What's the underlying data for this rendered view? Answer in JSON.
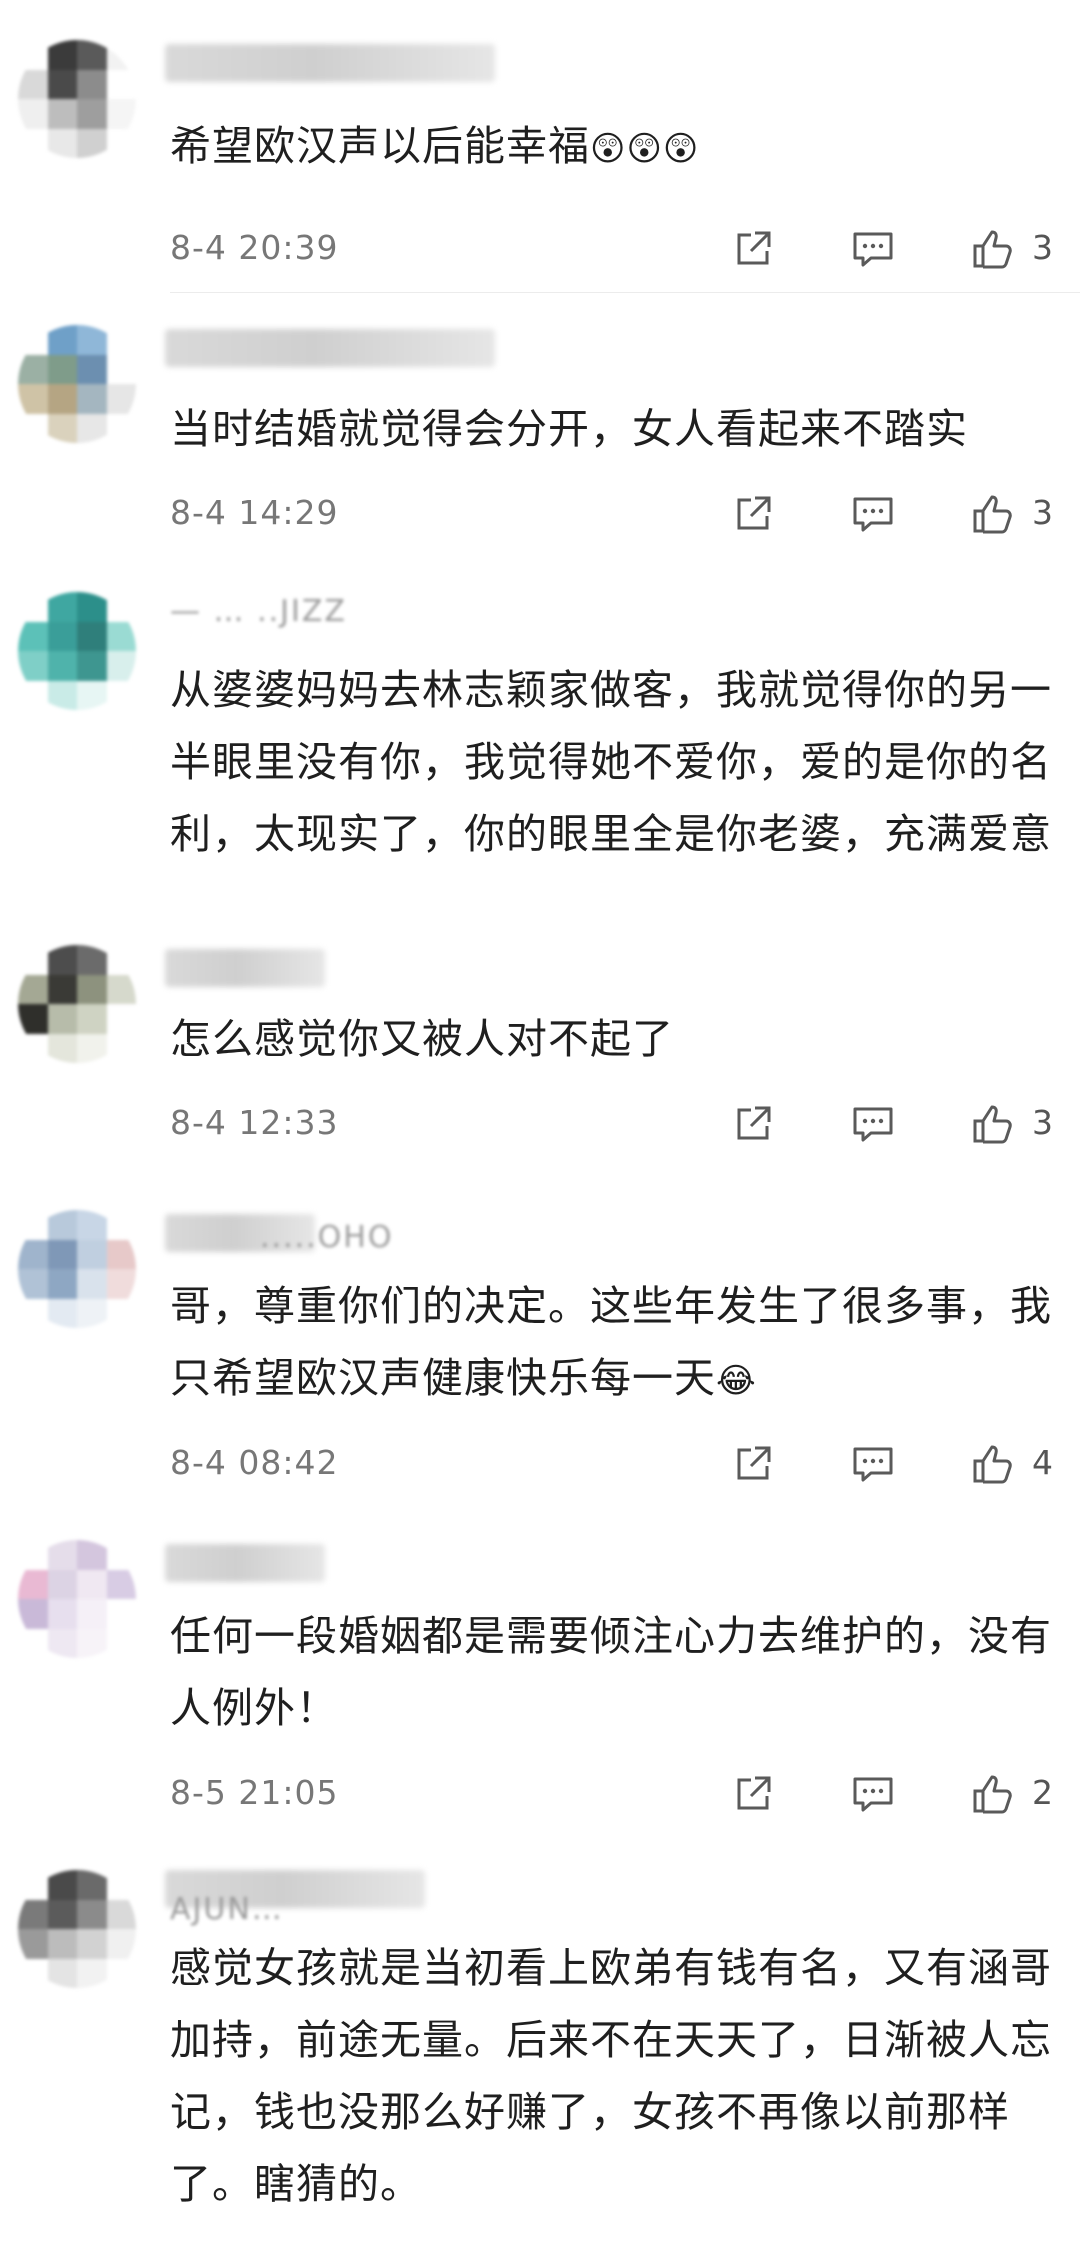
{
  "comments": [
    {
      "username": "",
      "text": "希望欧汉声以后能幸福",
      "emoji": "😲😲😲",
      "time": "8-4 20:39",
      "likes": "3",
      "avatar_colors": [
        "#ffffff",
        "#3b3b3b",
        "#5a5a5a",
        "#f2f2f2",
        "#d9d9d9",
        "#4a4a4a",
        "#8c8c8c",
        "#ffffff",
        "#efefef",
        "#bdbdbd",
        "#9e9e9e",
        "#f5f5f5",
        "#ffffff",
        "#e8e8e8",
        "#d0d0d0",
        "#ffffff"
      ]
    },
    {
      "username": "",
      "text": "当时结婚就觉得会分开，女人看起来不踏实",
      "emoji": "",
      "time": "8-4 14:29",
      "likes": "3",
      "avatar_colors": [
        "#ffffff",
        "#6fa0c8",
        "#8fb7d8",
        "#ffffff",
        "#9bb0a4",
        "#7f9c8a",
        "#6c8fb0",
        "#ffffff",
        "#cfc3a6",
        "#b5a583",
        "#a4b6c0",
        "#e6e6e6",
        "#ffffff",
        "#dad2bd",
        "#e7e7e7",
        "#ffffff"
      ]
    },
    {
      "username": "—  …  ..JIZZ",
      "text": "从婆婆妈妈去林志颖家做客，我就觉得你的另一半眼里没有你，我觉得她不爱你，爱的是你的名利，太现实了，你的眼里全是你老婆，充满爱意",
      "emoji": "",
      "time": "",
      "likes": "",
      "avatar_colors": [
        "#ffffff",
        "#3fa7a1",
        "#2c8f8a",
        "#ffffff",
        "#5cc1b8",
        "#3a9e99",
        "#2f7f7b",
        "#9adbd3",
        "#7fcfc7",
        "#4fb3ab",
        "#3e9690",
        "#d8efec",
        "#ffffff",
        "#c9ebe7",
        "#e7f6f4",
        "#ffffff"
      ]
    },
    {
      "username": "",
      "text": "怎么感觉你又被人对不起了",
      "emoji": "",
      "time": "8-4 12:33",
      "likes": "3",
      "avatar_colors": [
        "#ffffff",
        "#4d4d4d",
        "#6b6b6b",
        "#ffffff",
        "#a4a894",
        "#3a3a36",
        "#8d927e",
        "#d6d9cc",
        "#2f2f2b",
        "#b7bcaa",
        "#cfd3c3",
        "#ffffff",
        "#ffffff",
        "#e4e6dc",
        "#f1f2ec",
        "#ffffff"
      ]
    },
    {
      "username": ".....OHO",
      "text": "哥，尊重你们的决定。这些年发生了很多事，我只希望欧汉声健康快乐每一天",
      "emoji": "😂",
      "time": "8-4 08:42",
      "likes": "4",
      "avatar_colors": [
        "#ffffff",
        "#b8c9db",
        "#c8d6e6",
        "#ffffff",
        "#9fb4cc",
        "#7f98b7",
        "#c0cfe0",
        "#e7c9c9",
        "#b0c2d6",
        "#8ea7c3",
        "#d9e2ec",
        "#f0dcdc",
        "#ffffff",
        "#e3eaf2",
        "#eef2f6",
        "#ffffff"
      ]
    },
    {
      "username": "",
      "text": "任何一段婚姻都是需要倾注心力去维护的，没有人例外！",
      "emoji": "",
      "time": "8-5 21:05",
      "likes": "2",
      "avatar_colors": [
        "#ffffff",
        "#e5ddea",
        "#d4c6de",
        "#ffffff",
        "#e9b9d3",
        "#dcd3e4",
        "#f0e8f2",
        "#d8cce4",
        "#c9b9d8",
        "#e7dfee",
        "#f5f0f7",
        "#ffffff",
        "#ffffff",
        "#eee8f2",
        "#f7f3f8",
        "#ffffff"
      ]
    },
    {
      "username": "AJUN…",
      "text": "感觉女孩就是当初看上欧弟有钱有名，又有涵哥加持，前途无量。后来不在天天了，日渐被人忘记，钱也没那么好赚了，女孩不再像以前那样了。瞎猜的。",
      "emoji": "",
      "time": "",
      "likes": "",
      "avatar_colors": [
        "#ffffff",
        "#4a4a4a",
        "#6a6a6a",
        "#ffffff",
        "#7a7a7a",
        "#5b5b5b",
        "#8b8b8b",
        "#d9d9d9",
        "#9a9a9a",
        "#bcbcbc",
        "#d2d2d2",
        "#f0f0f0",
        "#ffffff",
        "#e4e4e4",
        "#f2f2f2",
        "#ffffff"
      ]
    }
  ],
  "icons": {
    "share": "share-icon",
    "reply": "comment-icon",
    "like": "thumbs-up-icon"
  },
  "colors": {
    "text": "#1f1f1f",
    "meta": "#777777",
    "icon": "#5a5a5a"
  }
}
